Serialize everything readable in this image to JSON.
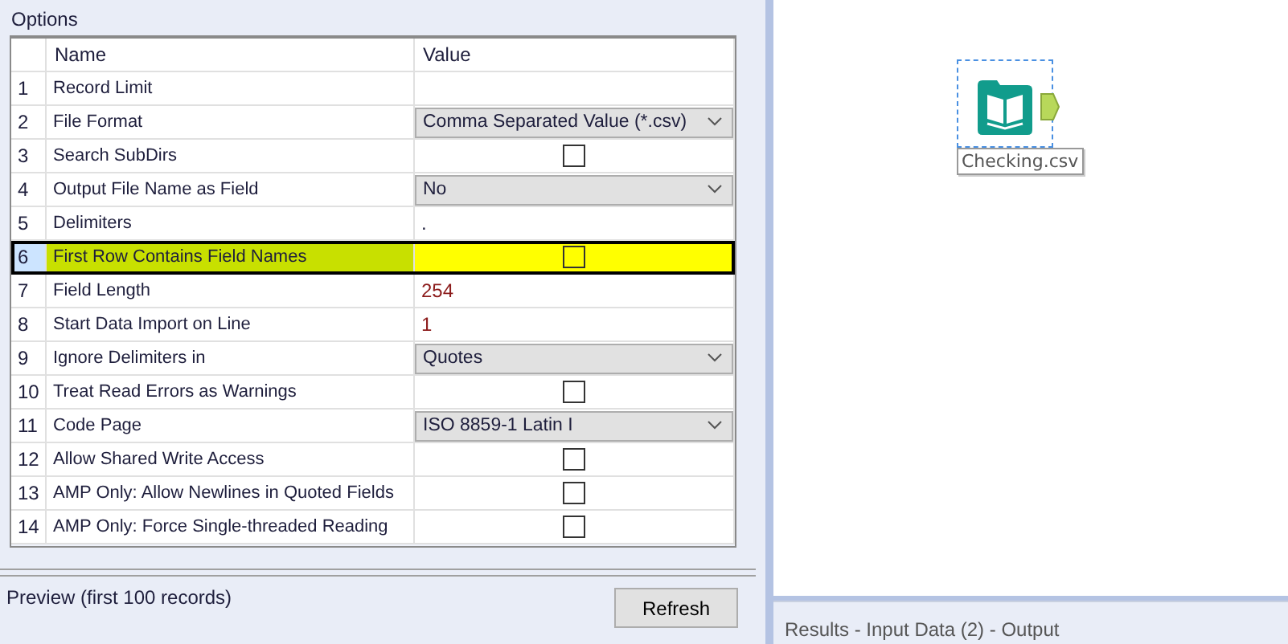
{
  "options": {
    "title": "Options",
    "columns": [
      "Name",
      "Value"
    ],
    "rows": [
      {
        "number": "1",
        "name": "Record Limit",
        "kind": "text",
        "value": "",
        "selected": false,
        "highlighted": false
      },
      {
        "number": "2",
        "name": "File Format",
        "kind": "dropdown",
        "value": "Comma Separated Value (*.csv)",
        "selected": false,
        "highlighted": false
      },
      {
        "number": "3",
        "name": "Search SubDirs",
        "kind": "checkbox",
        "checked": false,
        "selected": false,
        "highlighted": false
      },
      {
        "number": "4",
        "name": "Output File Name as Field",
        "kind": "dropdown",
        "value": "No",
        "selected": false,
        "highlighted": false
      },
      {
        "number": "5",
        "name": "Delimiters",
        "kind": "text",
        "value": ".",
        "selected": false,
        "highlighted": false
      },
      {
        "number": "6",
        "name": "First Row Contains Field Names",
        "kind": "checkbox",
        "checked": false,
        "selected": true,
        "highlighted": true
      },
      {
        "number": "7",
        "name": "Field Length",
        "kind": "text",
        "value": "254",
        "selected": false,
        "highlighted": false
      },
      {
        "number": "8",
        "name": "Start Data Import on Line",
        "kind": "text",
        "value": "1",
        "selected": false,
        "highlighted": false
      },
      {
        "number": "9",
        "name": "Ignore Delimiters in",
        "kind": "dropdown",
        "value": "Quotes",
        "selected": false,
        "highlighted": false
      },
      {
        "number": "10",
        "name": "Treat Read Errors as Warnings",
        "kind": "checkbox",
        "checked": false,
        "selected": false,
        "highlighted": false
      },
      {
        "number": "11",
        "name": "Code Page",
        "kind": "dropdown",
        "value": "ISO 8859-1 Latin I",
        "selected": false,
        "highlighted": false
      },
      {
        "number": "12",
        "name": "Allow Shared Write Access",
        "kind": "checkbox",
        "checked": false,
        "selected": false,
        "highlighted": false
      },
      {
        "number": "13",
        "name": "AMP Only: Allow Newlines in Quoted Fields",
        "kind": "checkbox",
        "checked": false,
        "selected": false,
        "highlighted": false
      },
      {
        "number": "14",
        "name": "AMP Only: Force Single-threaded Reading",
        "kind": "checkbox",
        "checked": false,
        "selected": false,
        "highlighted": false
      }
    ]
  },
  "preview": {
    "label": "Preview (first 100 records)",
    "button": "Refresh"
  },
  "canvas": {
    "node": {
      "label": "Checking.csv",
      "selected": true
    }
  },
  "results": {
    "title": "Results - Input Data (2) - Output"
  }
}
